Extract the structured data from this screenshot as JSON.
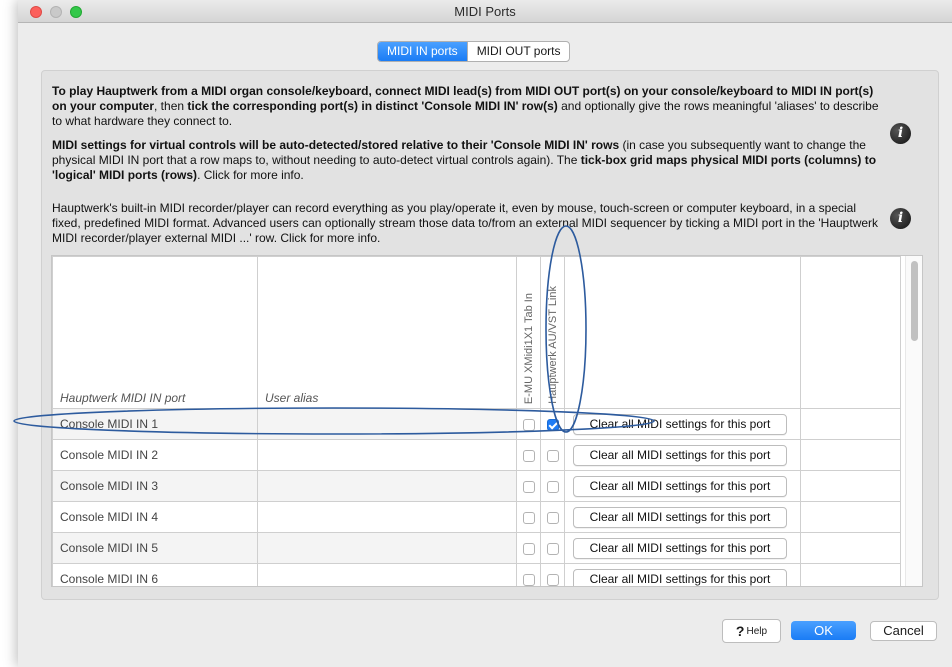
{
  "window": {
    "title": "MIDI Ports"
  },
  "tabs": [
    {
      "label": "MIDI IN ports",
      "active": true
    },
    {
      "label": "MIDI OUT ports",
      "active": false
    }
  ],
  "intro": {
    "p1_bold1": "To play Hauptwerk from a MIDI organ console/keyboard, connect MIDI lead(s) from MIDI OUT port(s) on your console/keyboard to MIDI IN port(s) on your computer",
    "p1_text1": ", then ",
    "p1_bold2": "tick the corresponding port(s) in distinct 'Console MIDI IN' row(s)",
    "p1_text2": " and optionally give the rows meaningful 'aliases' to describe to what hardware they connect to.",
    "p2_bold1": "MIDI settings for virtual controls will be auto-detected/stored relative to their 'Console MIDI IN' rows",
    "p2_text1": " (in case you subsequently want to change the physical MIDI IN port that a row maps to, without needing to auto-detect virtual controls again). The ",
    "p2_bold2": "tick-box grid maps physical MIDI ports (columns) to 'logical' MIDI ports (rows)",
    "p2_text2": ". Click for more info.",
    "p3_text": "Hauptwerk's built-in MIDI recorder/player can record everything as you play/operate it, even by mouse, touch-screen or computer keyboard, in a special fixed, predefined MIDI format. Advanced users can optionally stream those data to/from an external MIDI sequencer by ticking a MIDI port in the 'Hauptwerk MIDI recorder/player external MIDI ...' row. Click for more info.",
    "info_icon_glyph": "i"
  },
  "grid": {
    "col_port": "Hauptwerk MIDI IN port",
    "col_alias": "User alias",
    "col_emu": "E-MU XMidi1X1 Tab In",
    "col_hw": "Hauptwerk AU/VST Link",
    "rows": [
      {
        "port": "Console MIDI IN 1",
        "alias": "",
        "emu": false,
        "hw": true,
        "clear": "Clear all MIDI settings for this port"
      },
      {
        "port": "Console MIDI IN 2",
        "alias": "",
        "emu": false,
        "hw": false,
        "clear": "Clear all MIDI settings for this port"
      },
      {
        "port": "Console MIDI IN 3",
        "alias": "",
        "emu": false,
        "hw": false,
        "clear": "Clear all MIDI settings for this port"
      },
      {
        "port": "Console MIDI IN 4",
        "alias": "",
        "emu": false,
        "hw": false,
        "clear": "Clear all MIDI settings for this port"
      },
      {
        "port": "Console MIDI IN 5",
        "alias": "",
        "emu": false,
        "hw": false,
        "clear": "Clear all MIDI settings for this port"
      },
      {
        "port": "Console MIDI IN 6",
        "alias": "",
        "emu": false,
        "hw": false,
        "clear": "Clear all MIDI settings for this port"
      }
    ]
  },
  "footer": {
    "help_icon": "?",
    "help_label": "Help",
    "ok_label": "OK",
    "cancel_label": "Cancel"
  },
  "colors": {
    "accent": "#1a7cf5",
    "annotation": "#2d5b9e"
  }
}
